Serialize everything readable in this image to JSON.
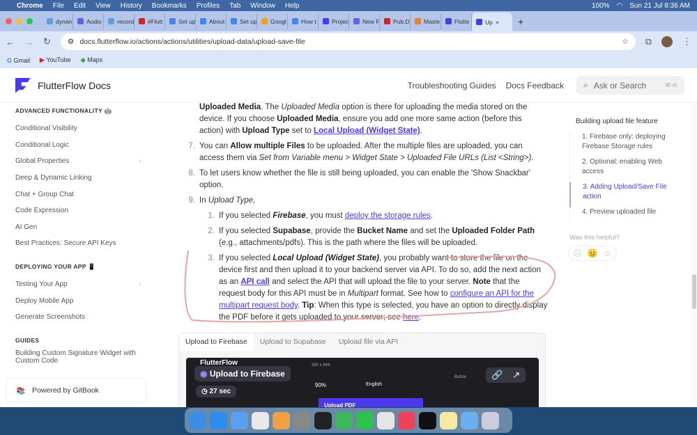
{
  "menubar": {
    "app": "Chrome",
    "items": [
      "File",
      "Edit",
      "View",
      "History",
      "Bookmarks",
      "Profiles",
      "Tab",
      "Window",
      "Help"
    ],
    "battery": "100%",
    "datetime": "Sun 21 Jul  8:36 AM"
  },
  "tabs": [
    {
      "label": "dynan",
      "color": "#5ba3e0"
    },
    {
      "label": "Audio",
      "color": "#6b5cf0"
    },
    {
      "label": "record",
      "color": "#5ba3e0"
    },
    {
      "label": "#Flutt",
      "color": "#e02020"
    },
    {
      "label": "Set up",
      "color": "#4285f4"
    },
    {
      "label": "About",
      "color": "#4285f4"
    },
    {
      "label": "Set up",
      "color": "#4285f4"
    },
    {
      "label": "Googl",
      "color": "#f4a300"
    },
    {
      "label": "How t",
      "color": "#4285f4"
    },
    {
      "label": "Projec",
      "color": "#4b39ef"
    },
    {
      "label": "New F",
      "color": "#6b5cf0"
    },
    {
      "label": "Pub.D",
      "color": "#e02020"
    },
    {
      "label": "Maste",
      "color": "#f08020"
    },
    {
      "label": "Flutte",
      "color": "#4b39ef"
    },
    {
      "label": "Up",
      "color": "#4b39ef",
      "active": true
    }
  ],
  "address": {
    "url": "docs.flutterflow.io/actions/actions/utilities/upload-data/upload-save-file"
  },
  "bookmarks": [
    "Gmail",
    "YouTube",
    "Maps"
  ],
  "header": {
    "brand": "FlutterFlow Docs",
    "nav": [
      "Troubleshooting Guides",
      "Docs Feedback"
    ],
    "search_placeholder": "Ask or Search",
    "search_shortcut": "⌘+K"
  },
  "sidebar": {
    "sections": [
      {
        "title": "ADVANCED FUNCTIONALITY 🤖",
        "items": [
          {
            "label": "Conditional Visibility"
          },
          {
            "label": "Conditional Logic"
          },
          {
            "label": "Global Properties",
            "chevron": true
          },
          {
            "label": "Deep & Dynamic Linking"
          },
          {
            "label": "Chat + Group Chat"
          },
          {
            "label": "Code Expression"
          },
          {
            "label": "AI Gen"
          },
          {
            "label": "Best Practices: Secure API Keys"
          }
        ]
      },
      {
        "title": "DEPLOYING YOUR APP 📱",
        "items": [
          {
            "label": "Testing Your App",
            "chevron": true
          },
          {
            "label": "Deploy Mobile App"
          },
          {
            "label": "Generate Screenshots"
          }
        ]
      },
      {
        "title": "GUIDES",
        "items": [
          {
            "label": "Building Custom Signature Widget with Custom Code"
          }
        ]
      }
    ],
    "powered_by": "Powered by GitBook"
  },
  "content": {
    "items": [
      {
        "num": "",
        "segs": [
          {
            "s": "b",
            "t": "Uploaded Media"
          },
          {
            "s": "",
            "t": ". The "
          },
          {
            "s": "i",
            "t": "Uploaded Media"
          },
          {
            "s": "",
            "t": " option is there for uploading the media stored on the device. If you choose "
          },
          {
            "s": "b",
            "t": "Uploaded Media"
          },
          {
            "s": "",
            "t": ", ensure you add one more same action (before this action) with "
          },
          {
            "s": "b",
            "t": "Upload Type"
          },
          {
            "s": "",
            "t": " set to "
          },
          {
            "s": "ab",
            "t": "Local Upload (Widget State)"
          },
          {
            "s": "",
            "t": "."
          }
        ]
      },
      {
        "num": "7.",
        "segs": [
          {
            "s": "",
            "t": "You can "
          },
          {
            "s": "b",
            "t": "Allow multiple Files"
          },
          {
            "s": "",
            "t": " to be uploaded. After the multiple files are uploaded, you can access them via "
          },
          {
            "s": "i",
            "t": "Set from Variable menu > Widget State > Uploaded File URLs (List <String>)."
          }
        ]
      },
      {
        "num": "8.",
        "segs": [
          {
            "s": "",
            "t": "To let users know whether the file is still being uploaded, you can enable the 'Show Snackbar' option."
          }
        ]
      },
      {
        "num": "9.",
        "segs": [
          {
            "s": "",
            "t": "In "
          },
          {
            "s": "i",
            "t": "Upload Type,"
          }
        ]
      }
    ],
    "subitems": [
      {
        "num": "1.",
        "segs": [
          {
            "s": "",
            "t": "If you selected "
          },
          {
            "s": "bi",
            "t": "Firebase"
          },
          {
            "s": "",
            "t": ", you must "
          },
          {
            "s": "a",
            "t": "deploy the storage rules"
          },
          {
            "s": "",
            "t": "."
          }
        ]
      },
      {
        "num": "2.",
        "segs": [
          {
            "s": "",
            "t": "If you selected "
          },
          {
            "s": "b",
            "t": "Supabase"
          },
          {
            "s": "",
            "t": ", provide the "
          },
          {
            "s": "b",
            "t": "Bucket Name"
          },
          {
            "s": "",
            "t": " and set the "
          },
          {
            "s": "b",
            "t": "Uploaded Folder Path"
          },
          {
            "s": "",
            "t": " (e.g., attachments/pdfs). This is the path where the files will be uploaded."
          }
        ]
      },
      {
        "num": "3.",
        "segs": [
          {
            "s": "",
            "t": "If you selected "
          },
          {
            "s": "bi",
            "t": "Local Upload (Widget State)"
          },
          {
            "s": "",
            "t": ", you probably want to store the file on the device first and then upload it to your backend server via API. To do so, add the next action as an "
          },
          {
            "s": "ab",
            "t": "API call"
          },
          {
            "s": "",
            "t": " and select the API that will upload the file to your server. "
          },
          {
            "s": "b",
            "t": "Note"
          },
          {
            "s": "",
            "t": " that the request body for this API must be in "
          },
          {
            "s": "i",
            "t": "Multipart"
          },
          {
            "s": "",
            "t": " format. See how to "
          },
          {
            "s": "a",
            "t": "configure an API for the multipart request body"
          },
          {
            "s": "",
            "t": ". "
          },
          {
            "s": "b",
            "t": "Tip"
          },
          {
            "s": "",
            "t": ": When this type is selected, you have an option to directly display the PDF before it gets uploaded to your server; see "
          },
          {
            "s": "a",
            "t": "here"
          },
          {
            "s": "",
            "t": "."
          }
        ]
      }
    ]
  },
  "video_tabs": [
    "Upload to Firebase",
    "Upload to Supabase",
    "Upload file via API"
  ],
  "video": {
    "app": "FlutterFlow",
    "title": "Upload to Firebase",
    "duration": "27 sec",
    "zoom": "90%",
    "language": "English",
    "button": "Upload PDF",
    "canvas": "390 x 844",
    "widget": "Button"
  },
  "toc": {
    "heading": "Building upload file feature",
    "items": [
      {
        "label": "1. Firebase only: deploying Firebase Storage rules"
      },
      {
        "label": "2. Optional: enabling Web access"
      },
      {
        "label": "3. Adding Upload/Save File action",
        "active": true
      },
      {
        "label": "4. Preview uploaded file"
      }
    ]
  },
  "helpful": "Was this helpful?"
}
